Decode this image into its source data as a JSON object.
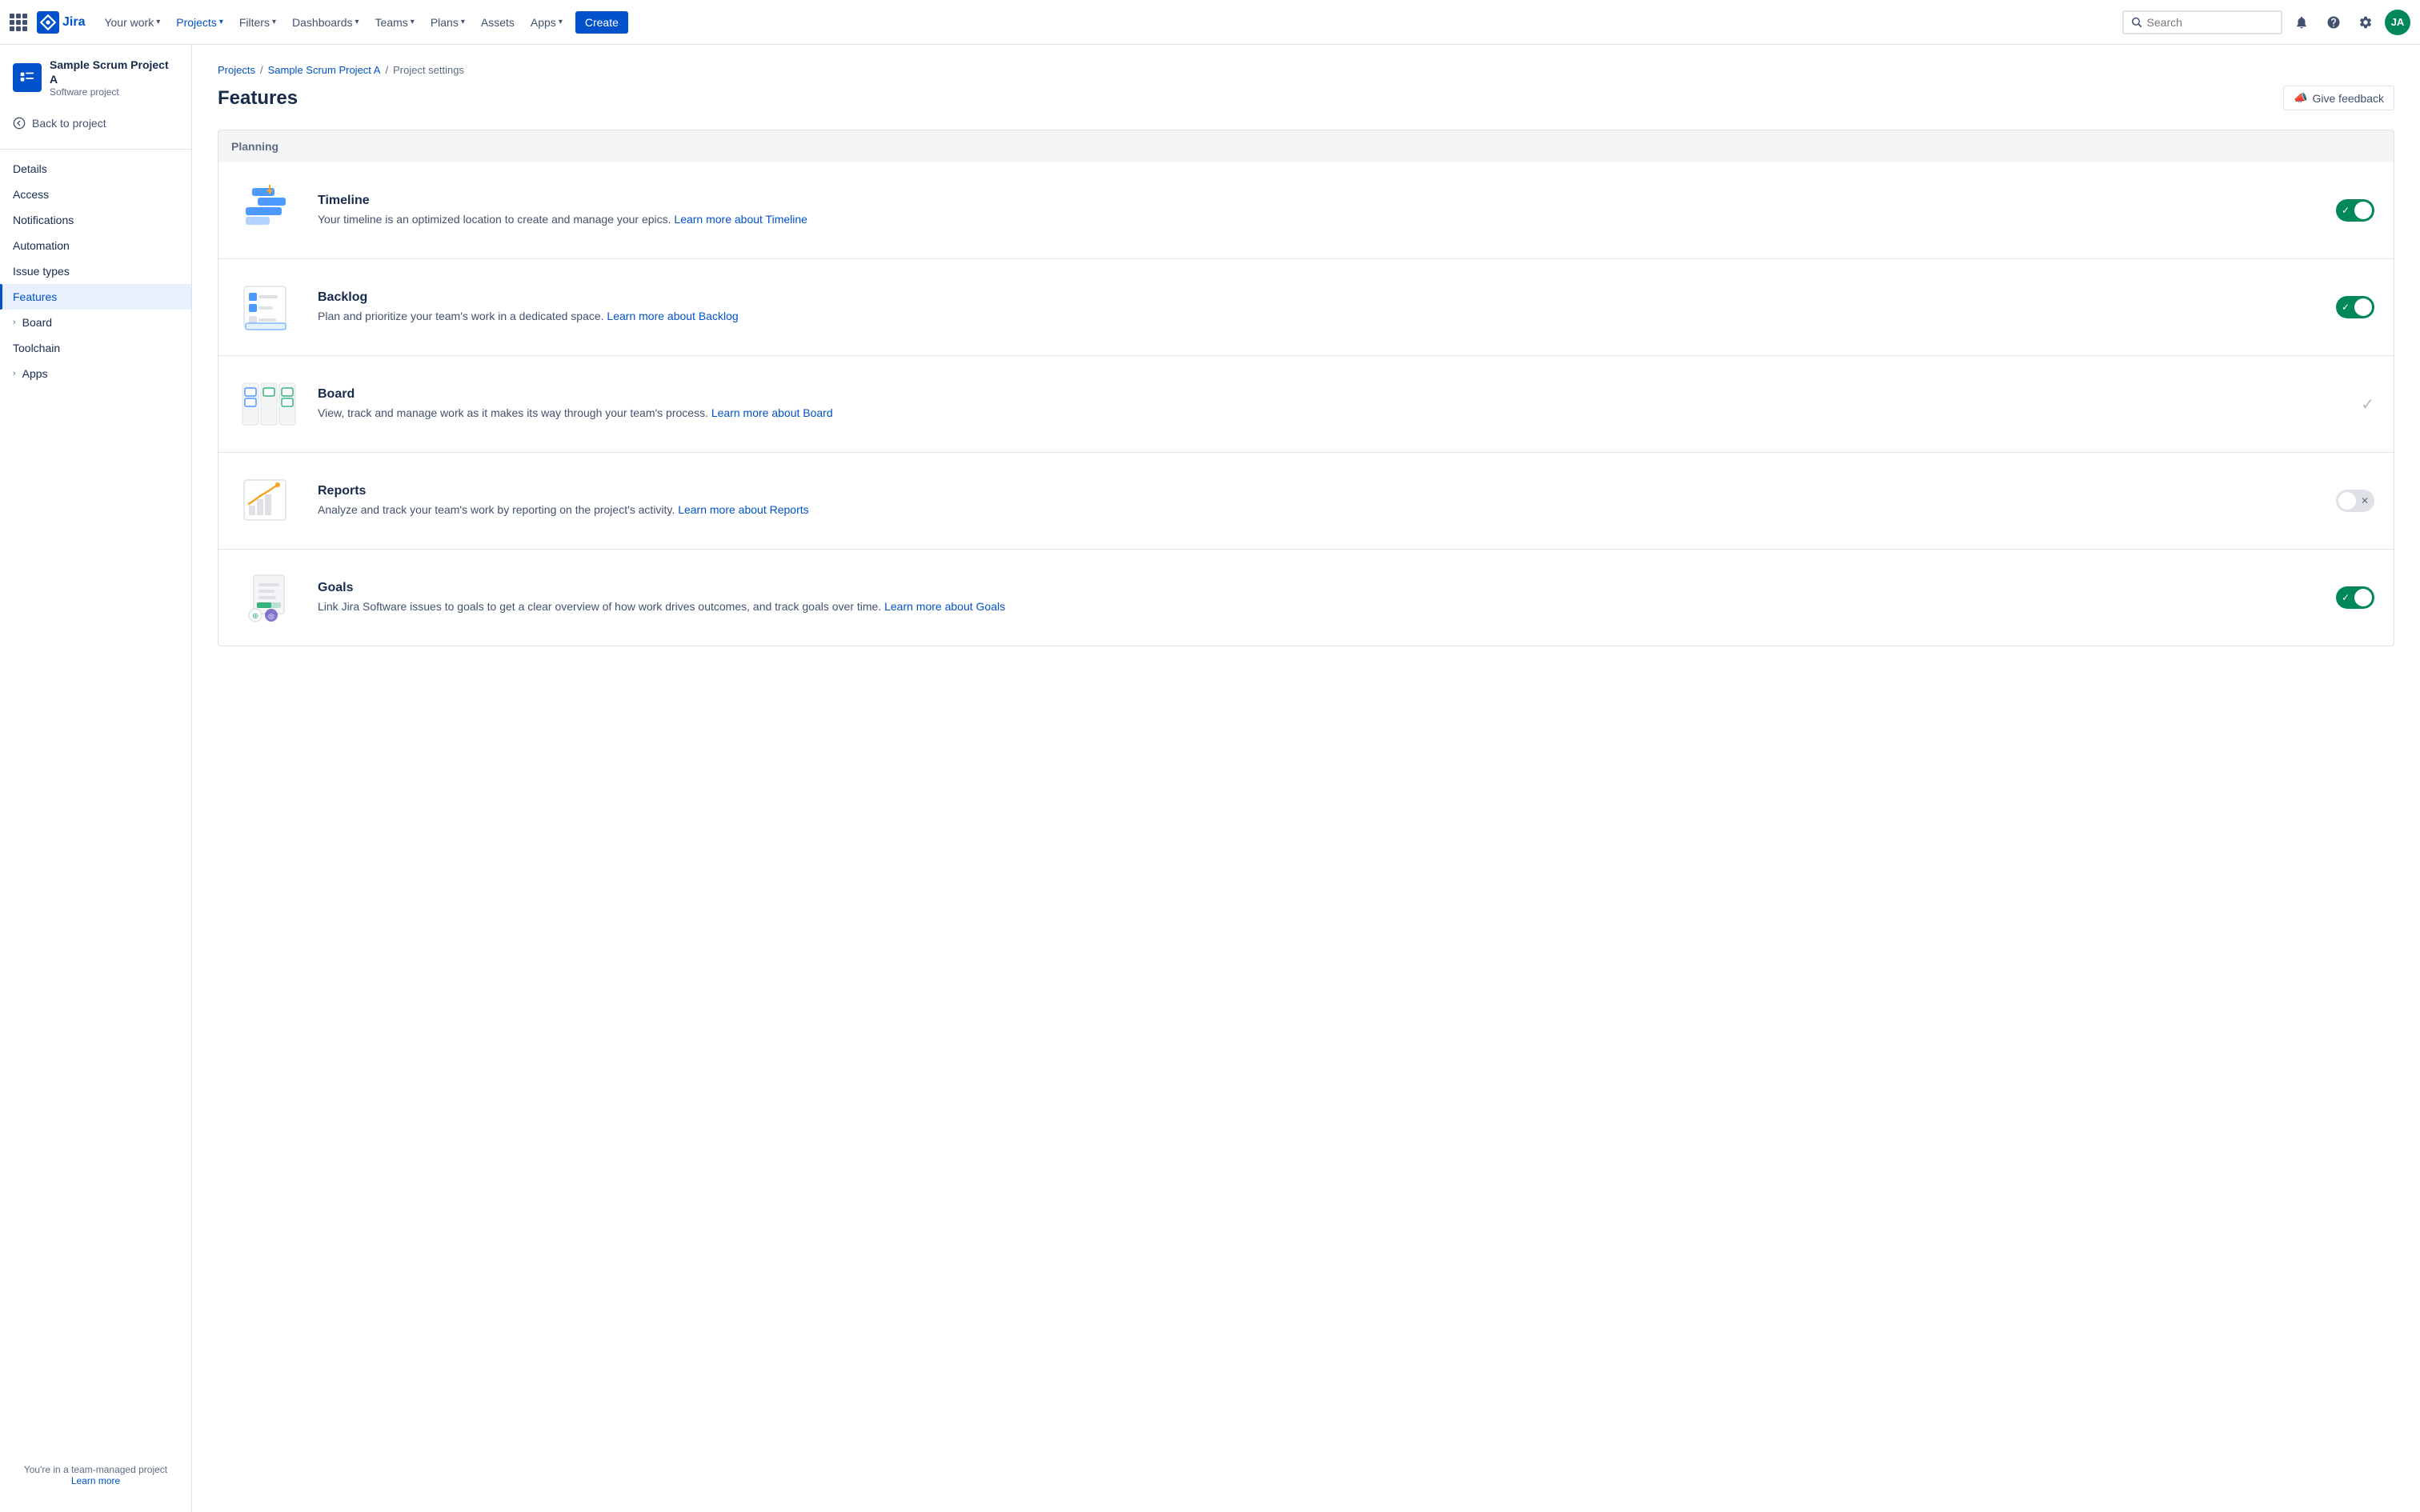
{
  "topnav": {
    "logo_text": "Jira",
    "nav_items": [
      {
        "label": "Your work",
        "has_dropdown": true
      },
      {
        "label": "Projects",
        "has_dropdown": true,
        "active": true
      },
      {
        "label": "Filters",
        "has_dropdown": true
      },
      {
        "label": "Dashboards",
        "has_dropdown": true
      },
      {
        "label": "Teams",
        "has_dropdown": true
      },
      {
        "label": "Plans",
        "has_dropdown": true
      },
      {
        "label": "Assets",
        "has_dropdown": false
      },
      {
        "label": "Apps",
        "has_dropdown": true
      }
    ],
    "create_label": "Create",
    "search_placeholder": "Search",
    "avatar_initials": "JA"
  },
  "sidebar": {
    "project_name": "Sample Scrum Project A",
    "project_type": "Software project",
    "back_label": "Back to project",
    "nav_items": [
      {
        "label": "Details",
        "active": false
      },
      {
        "label": "Access",
        "active": false
      },
      {
        "label": "Notifications",
        "active": false
      },
      {
        "label": "Automation",
        "active": false
      },
      {
        "label": "Issue types",
        "active": false
      },
      {
        "label": "Features",
        "active": true
      },
      {
        "label": "Board",
        "active": false,
        "expandable": true
      },
      {
        "label": "Toolchain",
        "active": false
      },
      {
        "label": "Apps",
        "active": false,
        "expandable": true
      }
    ],
    "footer_text": "You're in a team-managed project",
    "footer_link": "Learn more"
  },
  "breadcrumb": {
    "items": [
      "Projects",
      "Sample Scrum Project A",
      "Project settings"
    ]
  },
  "page": {
    "title": "Features",
    "give_feedback_label": "Give feedback"
  },
  "sections": [
    {
      "title": "Planning",
      "features": [
        {
          "name": "Timeline",
          "description": "Your timeline is an optimized location to create and manage your epics.",
          "link_text": "Learn more about Timeline",
          "toggle": "on",
          "toggle_type": "toggle"
        },
        {
          "name": "Backlog",
          "description": "Plan and prioritize your team's work in a dedicated space.",
          "link_text": "Learn more about Backlog",
          "toggle": "on",
          "toggle_type": "toggle"
        },
        {
          "name": "Board",
          "description": "View, track and manage work as it makes its way through your team's process.",
          "link_text": "Learn more about Board",
          "toggle": "check",
          "toggle_type": "check"
        },
        {
          "name": "Reports",
          "description": "Analyze and track your team's work by reporting on the project's activity.",
          "link_text": "Learn more about Reports",
          "toggle": "off",
          "toggle_type": "toggle"
        },
        {
          "name": "Goals",
          "description": "Link Jira Software issues to goals to get a clear overview of how work drives outcomes, and track goals over time.",
          "link_text": "Learn more about Goals",
          "toggle": "on",
          "toggle_type": "toggle"
        }
      ]
    }
  ]
}
